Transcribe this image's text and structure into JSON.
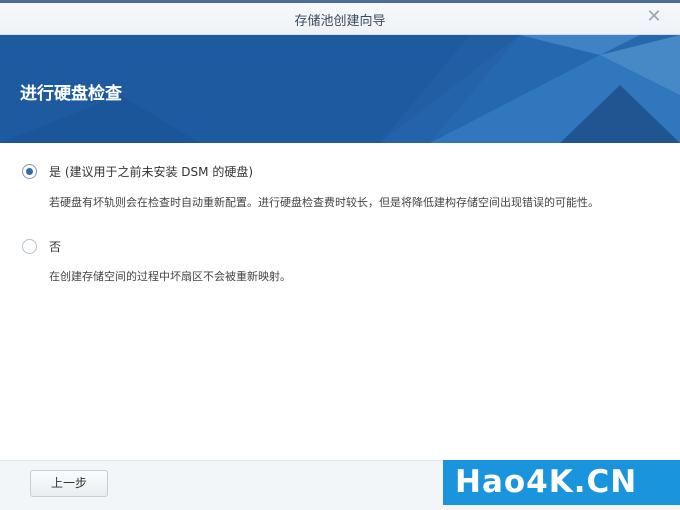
{
  "window": {
    "title": "存储池创建向导"
  },
  "banner": {
    "heading": "进行硬盘检查"
  },
  "options": [
    {
      "label": "是 (建议用于之前未安装 DSM 的硬盘)",
      "description": "若硬盘有坏轨则会在检查时自动重新配置。进行硬盘检查费时较长，但是将降低建构存储空间出现错误的可能性。",
      "selected": true
    },
    {
      "label": "否",
      "description": "在创建存储空间的过程中坏扇区不会被重新映射。",
      "selected": false
    }
  ],
  "footer": {
    "back_label": "上一步"
  },
  "watermark": {
    "text": "Hao4K.CN"
  },
  "colors": {
    "banner": "#1d5aa0",
    "accent": "#356aa5",
    "watermark": "#1a95dd"
  }
}
